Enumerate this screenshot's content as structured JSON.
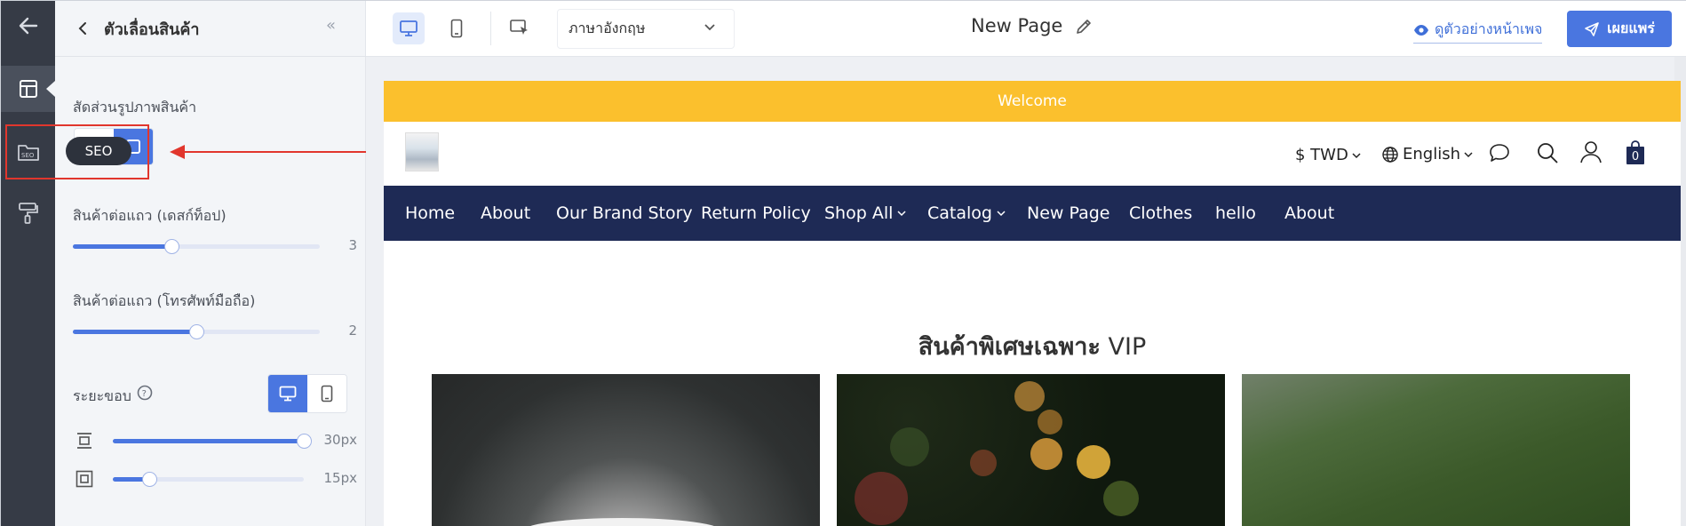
{
  "rail": {
    "items": [
      {
        "icon": "arrow-left-icon"
      },
      {
        "icon": "layout-icon"
      },
      {
        "icon": "seo-folder-icon"
      },
      {
        "icon": "paint-roller-icon"
      }
    ],
    "tooltip": "SEO"
  },
  "panel": {
    "title": "ตัวเลื่อนสินค้า",
    "image_ratio_label": "สัดส่วนรูปภาพสินค้า",
    "desktop_per_row": {
      "label": "สินค้าต่อแถว (เดสก์ท็อป)",
      "value": "3",
      "fraction": 0.4
    },
    "mobile_per_row": {
      "label": "สินค้าต่อแถว (โทรศัพท์มือถือ)",
      "value": "2",
      "fraction": 0.5
    },
    "margin": {
      "label": "ระยะขอบ",
      "vertical": {
        "value": "30px",
        "fraction": 1.0
      },
      "horizontal": {
        "value": "15px",
        "fraction": 0.19
      }
    }
  },
  "topbar": {
    "language": "ภาษาอังกฤษ",
    "page_name": "New Page",
    "preview_label": "ดูตัวอย่างหน้าเพจ",
    "publish_label": "เผยแพร่"
  },
  "site": {
    "welcome": "Welcome",
    "currency": "$ TWD",
    "language": "English",
    "cart_count": "0",
    "nav": [
      "Home",
      "About",
      "Our Brand Story",
      "Return Policy",
      "Shop All",
      "Catalog",
      "New Page",
      "Clothes",
      "hello",
      "About"
    ],
    "section_title_bold": "สินค้าพิเศษเฉพาะ",
    "section_title_rest": "VIP"
  },
  "colors": {
    "accent": "#4a76e0",
    "welcome_bar": "#fbc02d",
    "nav_bar": "#1e2a55",
    "highlight": "#e1362d"
  }
}
